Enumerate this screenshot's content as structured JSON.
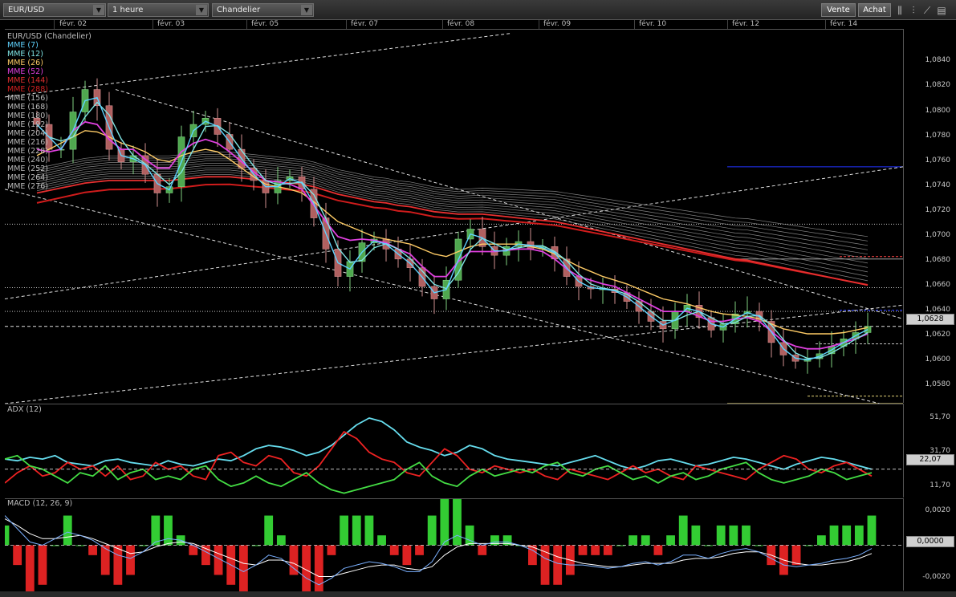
{
  "toolbar": {
    "symbol": "EUR/USD",
    "interval": "1 heure",
    "chart_style": "Chandelier",
    "sell_label": "Vente",
    "buy_label": "Achat"
  },
  "time_axis": [
    "févr. 02",
    "févr. 03",
    "févr. 05",
    "févr. 07",
    "févr. 08",
    "févr. 09",
    "févr. 10",
    "févr. 12",
    "févr. 14"
  ],
  "main_panel": {
    "title": "EUR/USD (Chandelier)",
    "legend": [
      {
        "label": "MME (7)",
        "color": "#5fd3ff"
      },
      {
        "label": "MME (12)",
        "color": "#7fe4e4"
      },
      {
        "label": "MME (26)",
        "color": "#ffcc66"
      },
      {
        "label": "MME (52)",
        "color": "#e040e0"
      },
      {
        "label": "MME (144)",
        "color": "#e03030"
      },
      {
        "label": "MME (288)",
        "color": "#d02020"
      },
      {
        "label": "MME (156)",
        "color": "#bbbbbb"
      },
      {
        "label": "MME (168)",
        "color": "#bbbbbb"
      },
      {
        "label": "MME (180)",
        "color": "#bbbbbb"
      },
      {
        "label": "MME (192)",
        "color": "#bbbbbb"
      },
      {
        "label": "MME (204)",
        "color": "#bbbbbb"
      },
      {
        "label": "MME (216)",
        "color": "#bbbbbb"
      },
      {
        "label": "MME (228)",
        "color": "#bbbbbb"
      },
      {
        "label": "MME (240)",
        "color": "#bbbbbb"
      },
      {
        "label": "MME (252)",
        "color": "#bbbbbb"
      },
      {
        "label": "MME (264)",
        "color": "#bbbbbb"
      },
      {
        "label": "MME (276)",
        "color": "#bbbbbb"
      }
    ],
    "y_ticks": [
      "1,0840",
      "1,0820",
      "1,0800",
      "1,0780",
      "1,0760",
      "1,0740",
      "1,0720",
      "1,0700",
      "1,0680",
      "1,0660",
      "1,0640",
      "1,0620",
      "1,0600",
      "1,0580"
    ],
    "current_value": "1,0628"
  },
  "adx_panel": {
    "title": "ADX (12)",
    "y_ticks": [
      "51,70",
      "31,70",
      "11,70"
    ],
    "current_value": "22,07"
  },
  "macd_panel": {
    "title": "MACD (12, 26, 9)",
    "y_ticks": [
      "0,0020",
      "-0,0020"
    ],
    "current_value": "0,0000"
  },
  "chart_data": [
    {
      "type": "candlestick",
      "title": "EUR/USD (Chandelier)",
      "x_labels": [
        "févr. 02",
        "févr. 03",
        "févr. 05",
        "févr. 07",
        "févr. 08",
        "févr. 09",
        "févr. 10",
        "févr. 12",
        "févr. 14"
      ],
      "ylim": [
        1.0566,
        1.0866
      ],
      "series": [
        {
          "name": "EUR/USD",
          "close": [
            1.079,
            1.077,
            1.077,
            1.08,
            1.0818,
            1.0805,
            1.077,
            1.076,
            1.0765,
            1.075,
            1.0735,
            1.074,
            1.078,
            1.079,
            1.0795,
            1.0782,
            1.077,
            1.0755,
            1.0745,
            1.0735,
            1.0745,
            1.0748,
            1.0738,
            1.0715,
            1.069,
            1.0668,
            1.068,
            1.0695,
            1.0698,
            1.069,
            1.0682,
            1.0675,
            1.066,
            1.065,
            1.0665,
            1.0698,
            1.0706,
            1.0692,
            1.0685,
            1.0692,
            1.0696,
            1.069,
            1.0692,
            1.0682,
            1.0668,
            1.066,
            1.0658,
            1.0658,
            1.0655,
            1.0648,
            1.064,
            1.0632,
            1.0626,
            1.064,
            1.0645,
            1.0635,
            1.0625,
            1.063,
            1.0638,
            1.064,
            1.0632,
            1.0615,
            1.0605,
            1.06,
            1.0602,
            1.0606,
            1.0612,
            1.0618,
            1.0623,
            1.0628
          ]
        },
        {
          "name": "MME (26)",
          "values": [
            1.077,
            1.0768,
            1.077,
            1.0785,
            1.0792,
            1.079,
            1.0778,
            1.077,
            1.077,
            1.0762,
            1.0755,
            1.0755,
            1.0768,
            1.0775,
            1.0778,
            1.0775,
            1.0768,
            1.076,
            1.0752,
            1.0745,
            1.0744,
            1.0742,
            1.0738,
            1.0725,
            1.0712,
            1.07,
            1.0697,
            1.0698,
            1.0697,
            1.0695,
            1.069,
            1.0686,
            1.0676,
            1.0668,
            1.0668,
            1.068,
            1.0688,
            1.0688,
            1.0688,
            1.0689,
            1.069,
            1.069,
            1.0688,
            1.0682,
            1.0674,
            1.0668,
            1.0665,
            1.0662,
            1.066,
            1.0655,
            1.065,
            1.0645,
            1.064,
            1.064,
            1.064,
            1.0636,
            1.0632,
            1.0632,
            1.0634,
            1.0635,
            1.0632,
            1.0624,
            1.0616,
            1.0612,
            1.061,
            1.061,
            1.0612,
            1.0615,
            1.0618,
            1.0622
          ]
        },
        {
          "name": "MME (52)",
          "values": [
            1.0765,
            1.077,
            1.0775,
            1.078,
            1.0785,
            1.0784,
            1.078,
            1.0775,
            1.0772,
            1.0768,
            1.0762,
            1.076,
            1.0765,
            1.0768,
            1.077,
            1.0768,
            1.0762,
            1.0755,
            1.0748,
            1.0742,
            1.074,
            1.0738,
            1.0735,
            1.0728,
            1.072,
            1.0712,
            1.0708,
            1.0704,
            1.07,
            1.0698,
            1.0696,
            1.0694,
            1.069,
            1.0686,
            1.0684,
            1.0688,
            1.0692,
            1.0694,
            1.0694,
            1.0694,
            1.0694,
            1.0692,
            1.069,
            1.0686,
            1.0681,
            1.0676,
            1.0672,
            1.0668,
            1.0665,
            1.0662,
            1.0658,
            1.0654,
            1.065,
            1.0648,
            1.0646,
            1.0643,
            1.064,
            1.0638,
            1.0637,
            1.0636,
            1.0634,
            1.063,
            1.0626,
            1.0624,
            1.0622,
            1.0622,
            1.0622,
            1.0623,
            1.0625,
            1.0627
          ]
        },
        {
          "name": "MME (144)",
          "values": [
            1.0735,
            1.0737,
            1.0739,
            1.0741,
            1.0743,
            1.0744,
            1.0745,
            1.0745,
            1.0745,
            1.0745,
            1.0745,
            1.0745,
            1.0746,
            1.0747,
            1.0748,
            1.0748,
            1.0748,
            1.0747,
            1.0746,
            1.0745,
            1.0744,
            1.0743,
            1.0742,
            1.074,
            1.0737,
            1.0734,
            1.0732,
            1.073,
            1.0728,
            1.0727,
            1.0725,
            1.0724,
            1.0722,
            1.072,
            1.0719,
            1.0718,
            1.0718,
            1.0718,
            1.0717,
            1.0716,
            1.0715,
            1.0714,
            1.0713,
            1.0712,
            1.071,
            1.0708,
            1.0706,
            1.0704,
            1.0702,
            1.07,
            1.0698,
            1.0696,
            1.0694,
            1.0692,
            1.069,
            1.0688,
            1.0686,
            1.0684,
            1.0682,
            1.0681,
            1.0679,
            1.0677,
            1.0675,
            1.0673,
            1.0671,
            1.0669,
            1.0667,
            1.0665,
            1.0663,
            1.0661
          ]
        }
      ]
    },
    {
      "type": "line",
      "title": "ADX (12)",
      "ylim": [
        5,
        60
      ],
      "series": [
        {
          "name": "ADX",
          "color": "#66ddee",
          "values": [
            28,
            27,
            29,
            28,
            30,
            26,
            25,
            24,
            27,
            28,
            26,
            25,
            24,
            27,
            25,
            24,
            26,
            28,
            27,
            30,
            34,
            36,
            35,
            33,
            30,
            32,
            36,
            42,
            48,
            52,
            50,
            45,
            38,
            35,
            33,
            30,
            32,
            36,
            34,
            30,
            28,
            27,
            26,
            25,
            24,
            26,
            28,
            30,
            27,
            24,
            22,
            24,
            27,
            28,
            26,
            24,
            25,
            27,
            29,
            28,
            26,
            24,
            22,
            25,
            27,
            29,
            28,
            26,
            24,
            22
          ]
        },
        {
          "name": "+DI",
          "color": "#ee2222",
          "values": [
            14,
            20,
            24,
            18,
            20,
            26,
            22,
            24,
            18,
            24,
            16,
            18,
            26,
            22,
            24,
            18,
            16,
            30,
            32,
            26,
            24,
            30,
            28,
            20,
            18,
            24,
            34,
            44,
            40,
            32,
            28,
            26,
            20,
            18,
            26,
            34,
            30,
            22,
            20,
            24,
            22,
            20,
            22,
            18,
            16,
            22,
            20,
            18,
            16,
            20,
            24,
            20,
            22,
            18,
            16,
            24,
            22,
            20,
            18,
            16,
            22,
            26,
            30,
            28,
            22,
            20,
            24,
            26,
            22,
            18
          ]
        },
        {
          "name": "-DI",
          "color": "#44dd44",
          "values": [
            28,
            30,
            24,
            22,
            18,
            14,
            20,
            18,
            24,
            16,
            20,
            22,
            16,
            18,
            16,
            22,
            24,
            16,
            12,
            14,
            18,
            14,
            12,
            16,
            20,
            14,
            10,
            8,
            10,
            12,
            14,
            16,
            22,
            26,
            18,
            14,
            12,
            18,
            22,
            18,
            20,
            22,
            20,
            24,
            26,
            20,
            18,
            22,
            24,
            20,
            16,
            18,
            14,
            18,
            20,
            16,
            18,
            22,
            24,
            26,
            20,
            16,
            14,
            16,
            18,
            22,
            20,
            16,
            18,
            20
          ]
        }
      ]
    },
    {
      "type": "bar",
      "title": "MACD (12, 26, 9)",
      "ylim": [
        -0.0028,
        0.0028
      ],
      "series": [
        {
          "name": "MACD",
          "color": "#7ab0ff",
          "values": [
            0.0018,
            0.001,
            0.0002,
            0.0,
            0.0004,
            0.0008,
            0.0006,
            0.0003,
            -0.0002,
            -0.0006,
            -0.0008,
            -0.0004,
            0.0002,
            0.0004,
            0.0003,
            0.0,
            -0.0004,
            -0.0008,
            -0.0012,
            -0.0016,
            -0.0012,
            -0.0006,
            -0.0008,
            -0.0014,
            -0.002,
            -0.0024,
            -0.002,
            -0.0014,
            -0.0012,
            -0.001,
            -0.0011,
            -0.0013,
            -0.0016,
            -0.0016,
            -0.001,
            0.0002,
            0.0006,
            0.0003,
            0.0,
            0.0002,
            0.0002,
            0.0,
            -0.0003,
            -0.0008,
            -0.0011,
            -0.0012,
            -0.0012,
            -0.0013,
            -0.0014,
            -0.0013,
            -0.0011,
            -0.001,
            -0.0012,
            -0.001,
            -0.0006,
            -0.0006,
            -0.0008,
            -0.0005,
            -0.0003,
            -0.0002,
            -0.0004,
            -0.0008,
            -0.0012,
            -0.0013,
            -0.0012,
            -0.0011,
            -0.0009,
            -0.0008,
            -0.0006,
            -0.0002
          ]
        },
        {
          "name": "Signal",
          "color": "#ffffff",
          "values": [
            0.0016,
            0.0012,
            0.0007,
            0.0004,
            0.0004,
            0.0005,
            0.0006,
            0.0004,
            0.0001,
            -0.0002,
            -0.0005,
            -0.0004,
            -0.0001,
            0.0001,
            0.0002,
            0.0001,
            -0.0002,
            -0.0005,
            -0.0008,
            -0.0011,
            -0.0012,
            -0.0009,
            -0.0009,
            -0.0011,
            -0.0015,
            -0.0019,
            -0.0019,
            -0.0017,
            -0.0015,
            -0.0013,
            -0.0012,
            -0.0012,
            -0.0014,
            -0.0015,
            -0.0013,
            -0.0006,
            -0.0001,
            0.0001,
            0.0001,
            0.0001,
            0.0001,
            0.0,
            -0.0001,
            -0.0004,
            -0.0007,
            -0.0009,
            -0.0011,
            -0.0012,
            -0.0013,
            -0.0013,
            -0.0012,
            -0.0011,
            -0.0011,
            -0.0011,
            -0.0009,
            -0.0008,
            -0.0008,
            -0.0007,
            -0.0005,
            -0.0004,
            -0.0004,
            -0.0006,
            -0.0009,
            -0.0011,
            -0.0012,
            -0.0012,
            -0.0011,
            -0.001,
            -0.0008,
            -0.0005
          ]
        }
      ]
    }
  ]
}
